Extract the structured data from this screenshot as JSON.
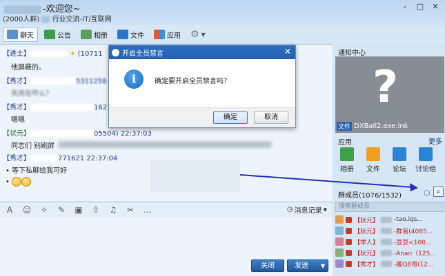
{
  "window": {
    "title_suffix": "-欢迎您~",
    "member_count_tag": "(2000人群)",
    "category": "行业交流-IT/互联网",
    "controls": [
      "–",
      "□",
      "✕"
    ]
  },
  "toolbar": {
    "items": [
      {
        "label": "聊天",
        "icon": "chat-icon"
      },
      {
        "label": "公告",
        "icon": "megaphone-icon"
      },
      {
        "label": "相册",
        "icon": "photo-icon"
      },
      {
        "label": "文件",
        "icon": "folder-icon"
      },
      {
        "label": "应用",
        "icon": "apps-icon"
      }
    ]
  },
  "messages": [
    {
      "rank": "【进士】",
      "id_partial": "(10711",
      "text": "他屏蔽的。"
    },
    {
      "rank": "【秀才】",
      "id_partial": "5311258",
      "text": "亮亮在咋么？"
    },
    {
      "rank": "【秀才】",
      "id_partial": "1621",
      "text": "嗯嗯"
    },
    {
      "rank": "【状元】",
      "id_partial": "05504)",
      "time": "22:37:03",
      "text": "同志们 别刷屏"
    },
    {
      "rank": "【秀才】",
      "id_partial": "771621",
      "time": "22:37:04",
      "text": "等下私聊给我可好"
    }
  ],
  "dialog": {
    "title": "开启全员禁言",
    "message": "确定要开启全员禁言吗？",
    "ok_label": "确定",
    "cancel_label": "取消",
    "close": "✕"
  },
  "input": {
    "record_label": "消息记录",
    "close_label": "关闭",
    "send_label": "发送"
  },
  "side": {
    "notice_title": "通知中心",
    "file_tag": "文件",
    "file_name": "DXBall2.exe.lnk",
    "apps_title": "应用",
    "more_label": "更多",
    "apps": [
      "相册",
      "文件",
      "论坛",
      "讨论组"
    ],
    "members_title": "群成员(1076/1532)",
    "search_placeholder": "搜索群成员",
    "members": [
      {
        "rank": "【状元】",
        "name": "-tao.iqs..."
      },
      {
        "rank": "【状元】",
        "name": "-群管(4085..."
      },
      {
        "rank": "【举人】",
        "name": "-豆豆<100..."
      },
      {
        "rank": "【状元】",
        "name": "-Anan（125..."
      },
      {
        "rank": "【秀才】",
        "name": "-搬Q8哥(12..."
      }
    ]
  },
  "colors": {
    "dialog_title": "#2f6dbf",
    "rank_blue": "#1d3a86",
    "rank_red": "#c41b1b",
    "arrow": "#1f2fb8"
  }
}
